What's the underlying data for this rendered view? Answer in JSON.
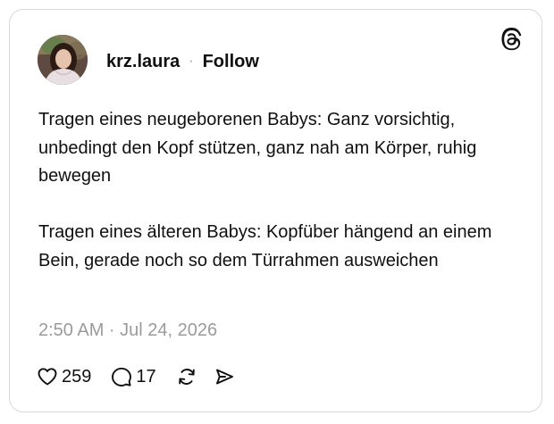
{
  "post": {
    "author": {
      "username": "krz.laura",
      "separator": "·",
      "follow_label": "Follow"
    },
    "body": {
      "paragraph_1": "Tragen eines neugeborenen Babys: Ganz vorsichtig, unbedingt den Kopf stützen, ganz nah am Körper, ruhig bewegen",
      "paragraph_2": "Tragen eines älteren Babys: Kopfüber hängend an einem Bein, gerade noch so dem Türrahmen ausweichen"
    },
    "timestamp": "2:50 AM · Jul 24, 2026",
    "actions": {
      "like_count": "259",
      "reply_count": "17"
    }
  },
  "icons": {
    "brand": "threads-logo-icon",
    "like": "heart-icon",
    "reply": "speech-bubble-icon",
    "repost": "repost-icon",
    "share": "paper-plane-icon"
  },
  "colors": {
    "text": "#101010",
    "muted": "#9b9b9b",
    "border": "#d9d9d9",
    "background": "#ffffff"
  }
}
